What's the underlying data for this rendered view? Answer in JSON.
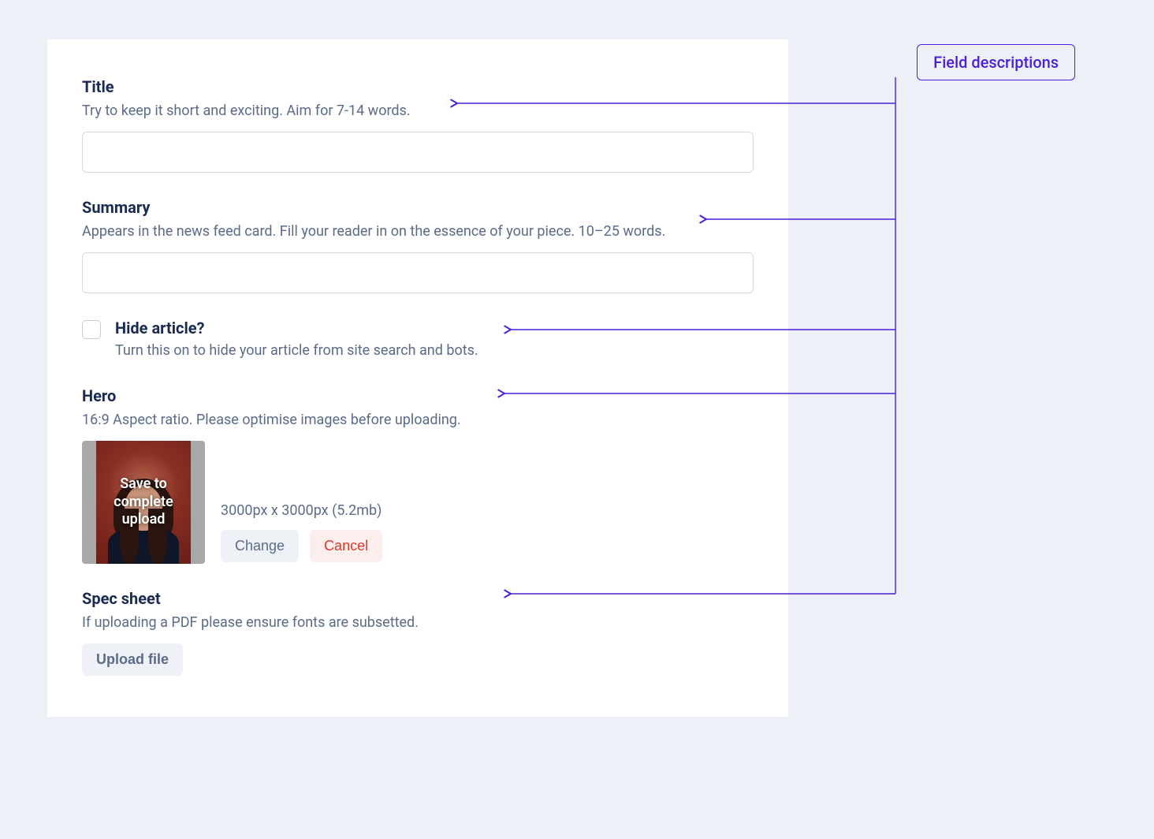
{
  "callout": {
    "label": "Field descriptions"
  },
  "fields": {
    "title": {
      "label": "Title",
      "desc": "Try to keep it short and exciting. Aim for 7-14 words.",
      "value": ""
    },
    "summary": {
      "label": "Summary",
      "desc": "Appears in the news feed card.  Fill your reader in on the essence of your piece. 10–25 words.",
      "value": ""
    },
    "hide": {
      "label": "Hide article?",
      "desc": "Turn this on to hide your article from site search and bots.",
      "checked": false
    },
    "hero": {
      "label": "Hero",
      "desc": "16:9 Aspect ratio. Please optimise images before uploading.",
      "overlay": "Save to complete upload",
      "dims": "3000px x 3000px (5.2mb)",
      "change": "Change",
      "cancel": "Cancel"
    },
    "spec": {
      "label": "Spec sheet",
      "desc": "If uploading a PDF please ensure fonts are subsetted.",
      "upload": "Upload file"
    }
  }
}
